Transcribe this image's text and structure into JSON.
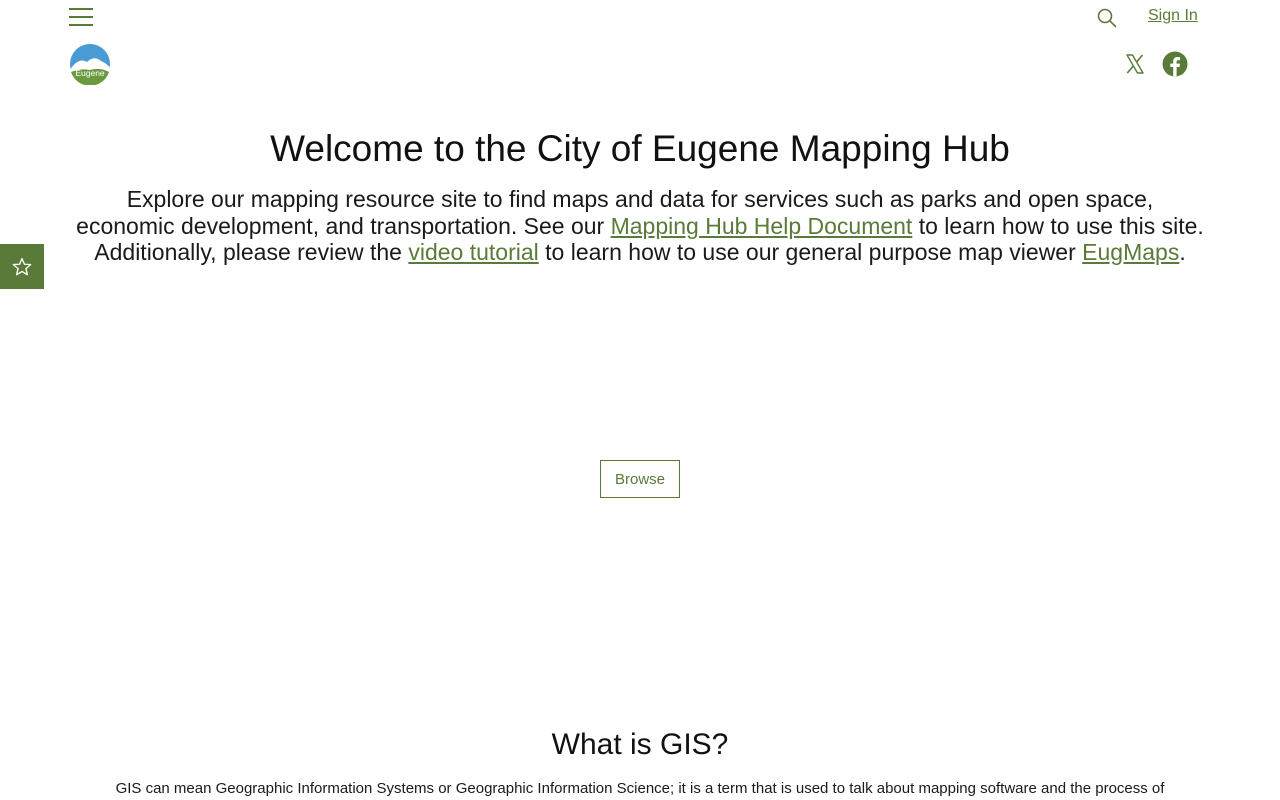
{
  "header": {
    "menu_icon": "hamburger-menu-icon",
    "logo_text": "Eugene",
    "search_icon": "search-icon",
    "sign_in_label": "Sign In",
    "social": {
      "x_icon": "x-twitter-icon",
      "facebook_icon": "facebook-icon"
    }
  },
  "follow_tab": {
    "icon": "star-icon"
  },
  "hero": {
    "title": "Welcome to the City of Eugene Mapping Hub",
    "desc_part1": "Explore our mapping resource site to find maps and data for services such as parks and open space, economic development, and transportation. See our ",
    "help_link": "Mapping Hub Help Document",
    "desc_part2": " to learn how to use this site. Additionally, please review the ",
    "video_link": "video tutorial",
    "desc_part3": " to learn how to use our general purpose map viewer ",
    "eugmaps_link": "EugMaps",
    "desc_part4": "."
  },
  "browse_label": "Browse",
  "gis_section": {
    "title": "What is GIS?",
    "text": "GIS can mean Geographic Information Systems or Geographic Information Science; it is a term that is used to talk about mapping software and the process of"
  },
  "colors": {
    "accent": "#5a7a3a",
    "text": "#111111",
    "background": "#ffffff"
  }
}
